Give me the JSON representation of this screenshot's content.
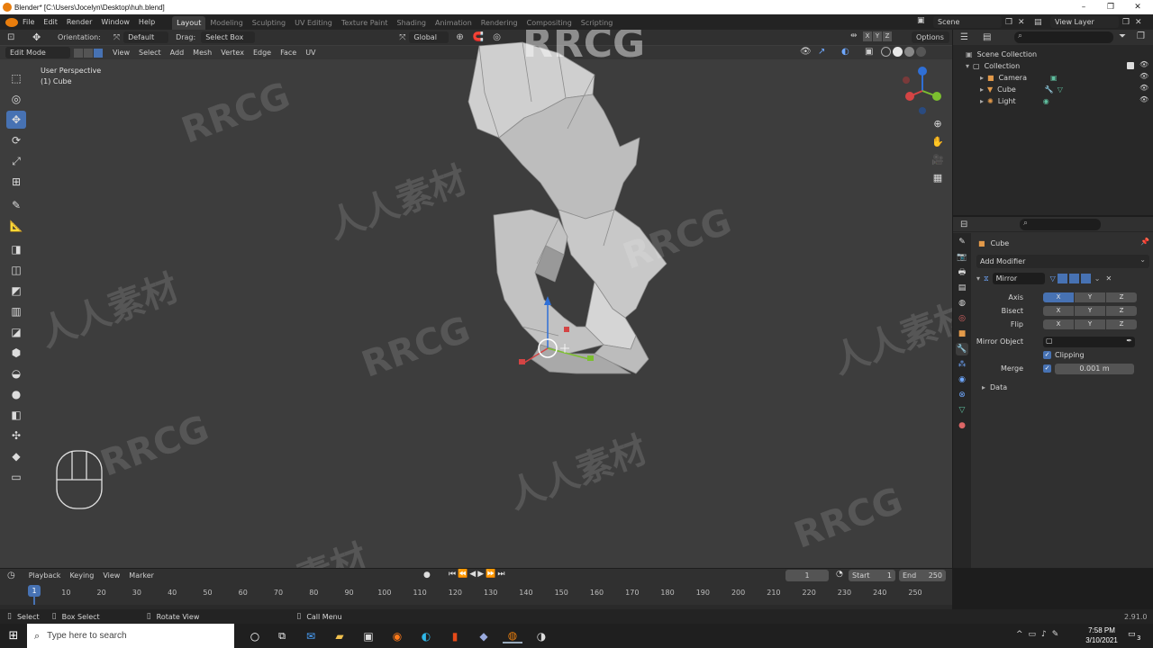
{
  "window": {
    "title": "Blender* [C:\\Users\\Jocelyn\\Desktop\\huh.blend]"
  },
  "menu": [
    "File",
    "Edit",
    "Render",
    "Window",
    "Help"
  ],
  "workspaces": [
    {
      "label": "Layout",
      "active": true
    },
    {
      "label": "Modeling",
      "active": false
    },
    {
      "label": "Sculpting",
      "active": false
    },
    {
      "label": "UV Editing",
      "active": false
    },
    {
      "label": "Texture Paint",
      "active": false
    },
    {
      "label": "Shading",
      "active": false
    },
    {
      "label": "Animation",
      "active": false
    },
    {
      "label": "Rendering",
      "active": false
    },
    {
      "label": "Compositing",
      "active": false
    },
    {
      "label": "Scripting",
      "active": false
    }
  ],
  "scene": {
    "label": "Scene",
    "view_layer": "View Layer"
  },
  "tool_header": {
    "orientation_label": "Orientation:",
    "orientation_value": "Default",
    "drag_label": "Drag:",
    "drag_value": "Select Box",
    "transform_orientation": "Global",
    "options": "Options"
  },
  "viewport_header": {
    "mode": "Edit Mode",
    "menus": [
      "View",
      "Select",
      "Add",
      "Mesh",
      "Vertex",
      "Edge",
      "Face",
      "UV"
    ],
    "axis_toggles": [
      "X",
      "Y",
      "Z"
    ]
  },
  "viewport": {
    "perspective": "User Perspective",
    "object": "(1) Cube"
  },
  "outliner": {
    "root": "Scene Collection",
    "collection": "Collection",
    "items": [
      "Camera",
      "Cube",
      "Light"
    ]
  },
  "properties": {
    "object_name": "Cube",
    "add_modifier": "Add Modifier",
    "modifier_name": "Mirror",
    "axis_label": "Axis",
    "bisect_label": "Bisect",
    "flip_label": "Flip",
    "xyz": [
      "X",
      "Y",
      "Z"
    ],
    "mirror_object_label": "Mirror Object",
    "clipping_label": "Clipping",
    "merge_label": "Merge",
    "merge_value": "0.001 m",
    "data_label": "Data"
  },
  "timeline": {
    "menus": [
      "Playback",
      "Keying",
      "View",
      "Marker"
    ],
    "current_frame": "1",
    "start_label": "Start",
    "start_value": "1",
    "end_label": "End",
    "end_value": "250",
    "ruler_ticks": [
      "1",
      "10",
      "20",
      "30",
      "40",
      "50",
      "60",
      "70",
      "80",
      "90",
      "100",
      "110",
      "120",
      "130",
      "140",
      "150",
      "160",
      "170",
      "180",
      "190",
      "200",
      "210",
      "220",
      "230",
      "240",
      "250"
    ]
  },
  "statusbar": {
    "select": "Select",
    "box_select": "Box Select",
    "rotate_view": "Rotate View",
    "call_menu": "Call Menu",
    "version": "2.91.0"
  },
  "taskbar": {
    "search_placeholder": "Type here to search",
    "time": "7:58 PM",
    "date": "3/10/2021",
    "notifications": "3"
  },
  "watermark": {
    "text_latin": "RRCG",
    "text_cjk": "人人素材"
  },
  "colors": {
    "accent": "#4772b3",
    "viewport_bg": "#3d3d3d",
    "panel_bg": "#303030"
  }
}
